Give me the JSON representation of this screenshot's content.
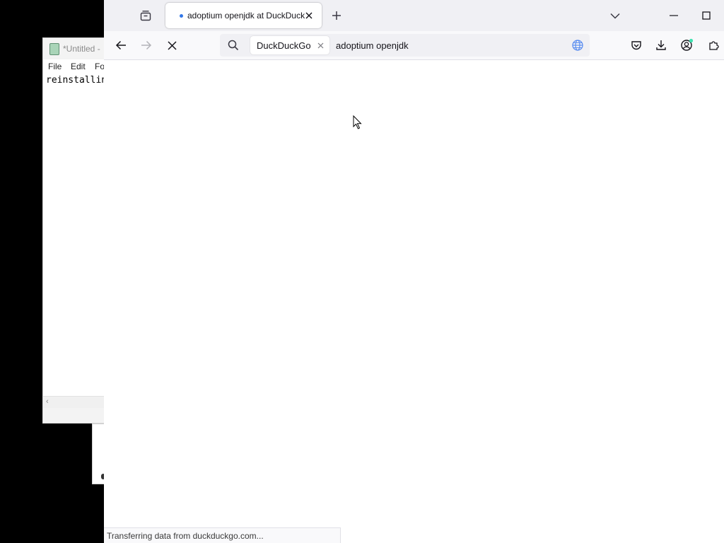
{
  "notepad": {
    "title": "*Untitled -",
    "menu": [
      "File",
      "Edit",
      "Fo"
    ],
    "text": "reinstallin"
  },
  "browser": {
    "tab": {
      "title": "adoptium openjdk at DuckDuckGo",
      "status": "loading"
    },
    "search_engine": "DuckDuckGo",
    "url_value": "adoptium openjdk",
    "status_text": "Transferring data from duckduckgo.com...",
    "colors": {
      "loading_dot": "#3277e8",
      "globe_icon": "#5b8ef0",
      "account_badge": "#3fe1b0"
    }
  },
  "icons": {
    "tab_list": "tab-list-icon",
    "tab_close": "close-icon",
    "new_tab": "plus-icon",
    "list_all_tabs": "chevron-down-icon",
    "minimize": "minimize-icon",
    "maximize": "maximize-icon",
    "back": "back-arrow-icon",
    "forward": "forward-arrow-icon",
    "stop": "stop-icon",
    "search": "search-icon",
    "engine_remove": "close-icon",
    "globe": "globe-icon",
    "pocket": "pocket-icon",
    "downloads": "download-icon",
    "account": "account-icon",
    "extensions": "extensions-icon"
  }
}
